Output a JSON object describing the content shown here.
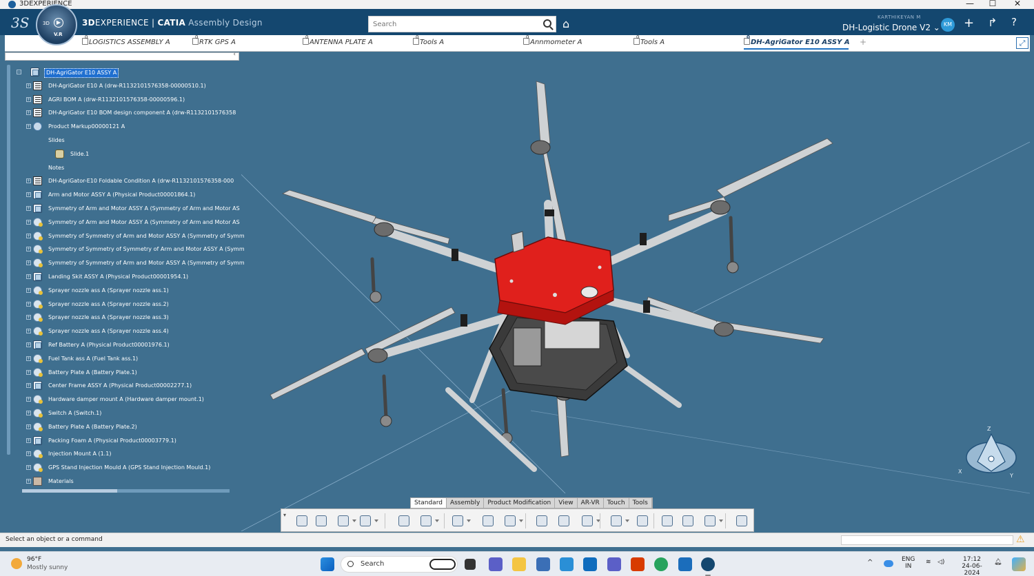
{
  "window": {
    "title": "3DEXPERIENCE",
    "min": "—",
    "max": "☐",
    "close": "✕"
  },
  "header": {
    "brand_logo": "3S",
    "compass_3d": "3D",
    "compass_vr": "V.R",
    "app_bold_1": "3D",
    "app_rest_1": "EXPERIENCE | ",
    "app_bold_2": "CATIA",
    "app_sub": " Assembly Design",
    "search_placeholder": "Search",
    "user": "KARTHIKEYAN M",
    "collab_space": "DH-Logistic Drone V2 ⌄",
    "avatar_initials": "KM",
    "icons": [
      "tag-icon",
      "add-icon",
      "share-icon",
      "help-icon"
    ]
  },
  "tabs": [
    {
      "label": "LOGISTICS ASSEMBLY A",
      "active": false
    },
    {
      "label": "RTK GPS A",
      "active": false
    },
    {
      "label": "ANTENNA PLATE A",
      "active": false
    },
    {
      "label": "Tools A",
      "active": false
    },
    {
      "label": "Annmometer A",
      "active": false
    },
    {
      "label": "Tools A",
      "active": false
    },
    {
      "label": "DH-AgriGator E10 ASSY A",
      "active": true
    }
  ],
  "tab_plus": "+",
  "tab_expand": "⤢",
  "panel_close": "‹",
  "tree": [
    {
      "label": "DH-AgriGator E10 ASSY A",
      "icon": "product-icon",
      "level": 0,
      "root": true
    },
    {
      "label": "DH-AgriGator E10 A (drw-R1132101576358-00000510.1)",
      "icon": "drawing-icon",
      "level": 1
    },
    {
      "label": "AGRI BOM A (drw-R1132101576358-00000596.1)",
      "icon": "drawing-icon",
      "level": 1
    },
    {
      "label": "DH-AgriGator E10 BOM design component A (drw-R1132101576358",
      "icon": "drawing-icon",
      "level": 1
    },
    {
      "label": "Product Markup00000121 A",
      "icon": "markup-icon",
      "level": 1
    },
    {
      "label": "Slides",
      "icon": "",
      "level": 2,
      "plain": true
    },
    {
      "label": "Slide.1",
      "icon": "slide-icon",
      "level": 3
    },
    {
      "label": "Notes",
      "icon": "",
      "level": 2,
      "plain": true
    },
    {
      "label": "DH-AgriGator-E10 Foldable Condition A (drw-R1132101576358-000",
      "icon": "drawing-icon",
      "level": 1
    },
    {
      "label": "Arm and Motor ASSY A (Physical Product00001864.1)",
      "icon": "product-icon",
      "level": 1
    },
    {
      "label": "Symmetry of Arm and Motor ASSY A (Symmetry of Arm and Motor AS",
      "icon": "product-icon",
      "level": 1
    },
    {
      "label": "Symmetry of Arm and Motor ASSY A (Symmetry of Arm and Motor AS",
      "icon": "part-icon",
      "level": 1
    },
    {
      "label": "Symmetry of Symmetry of Arm and Motor ASSY A (Symmetry of Symm",
      "icon": "part-icon",
      "level": 1
    },
    {
      "label": "Symmetry of Symmetry of Symmetry of Arm and Motor ASSY A (Symm",
      "icon": "part-icon",
      "level": 1
    },
    {
      "label": "Symmetry of Symmetry of Arm and Motor ASSY A (Symmetry of Symm",
      "icon": "part-icon",
      "level": 1
    },
    {
      "label": "Landing Skit ASSY A (Physical Product00001954.1)",
      "icon": "product-icon",
      "level": 1
    },
    {
      "label": "Sprayer nozzle ass A (Sprayer nozzle ass.1)",
      "icon": "part-icon",
      "level": 1
    },
    {
      "label": "Sprayer nozzle ass A (Sprayer nozzle ass.2)",
      "icon": "part-icon",
      "level": 1
    },
    {
      "label": "Sprayer nozzle ass A (Sprayer nozzle ass.3)",
      "icon": "part-icon",
      "level": 1
    },
    {
      "label": "Sprayer nozzle ass A (Sprayer nozzle ass.4)",
      "icon": "part-icon",
      "level": 1
    },
    {
      "label": "Ref Battery A (Physical Product00001976.1)",
      "icon": "product-icon",
      "level": 1
    },
    {
      "label": "Fuel Tank ass A (Fuel Tank ass.1)",
      "icon": "part-icon",
      "level": 1
    },
    {
      "label": "Battery Plate A (Battery Plate.1)",
      "icon": "part-icon",
      "level": 1
    },
    {
      "label": "Center Frame ASSY A (Physical Product00002277.1)",
      "icon": "product-icon",
      "level": 1
    },
    {
      "label": "Hardware damper mount A (Hardware damper mount.1)",
      "icon": "part-icon",
      "level": 1
    },
    {
      "label": "Switch A (Switch.1)",
      "icon": "part-icon",
      "level": 1
    },
    {
      "label": "Battery Plate A (Battery Plate.2)",
      "icon": "part-icon",
      "level": 1
    },
    {
      "label": "Packing Foam A (Physical Product00003779.1)",
      "icon": "product-icon",
      "level": 1
    },
    {
      "label": "Injection Mount A (1.1)",
      "icon": "part-icon",
      "level": 1
    },
    {
      "label": "GPS Stand Injection Mould A (GPS Stand Injection Mould.1)",
      "icon": "part-icon",
      "level": 1
    },
    {
      "label": "Materials",
      "icon": "materials-icon",
      "level": 1
    }
  ],
  "compass_axes": {
    "z": "Z",
    "x": "X",
    "y": "Y"
  },
  "command_tabs": [
    {
      "label": "Standard",
      "active": true
    },
    {
      "label": "Assembly",
      "active": false
    },
    {
      "label": "Product Modification",
      "active": false
    },
    {
      "label": "View",
      "active": false
    },
    {
      "label": "AR-VR",
      "active": false
    },
    {
      "label": "Touch",
      "active": false
    },
    {
      "label": "Tools",
      "active": false
    }
  ],
  "toolbar_icons": [
    "cut-icon",
    "copy-icon",
    "paste-icon",
    "undo-icon",
    "zoom-icon",
    "update-icon",
    "insert-icon",
    "replace-icon",
    "fix-icon",
    "explode-icon",
    "gear-group-icon",
    "clash-icon",
    "axis-icon",
    "bom-icon",
    "inspect-icon",
    "drone-icon",
    "manipulate-icon",
    "robot-icon"
  ],
  "status": {
    "message": "Select an object or a command",
    "warning": "⚠"
  },
  "taskbar": {
    "weather_temp": "96°F",
    "weather_desc": "Mostly sunny",
    "search_label": "Search",
    "lang_top": "ENG",
    "lang_bottom": "IN",
    "time": "17:12",
    "date": "24-06-2024"
  }
}
